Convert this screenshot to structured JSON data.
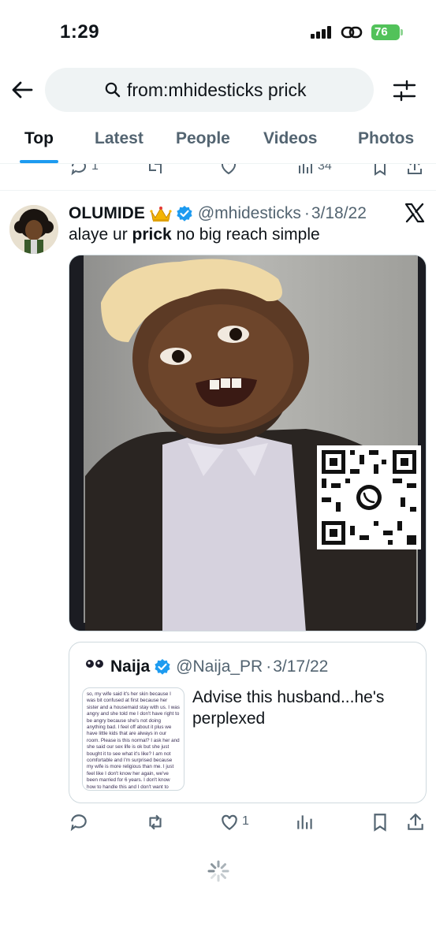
{
  "status_bar": {
    "time": "1:29",
    "battery": "76"
  },
  "search": {
    "query": "from:mhidesticks prick"
  },
  "tabs": [
    {
      "label": "Top",
      "active": true
    },
    {
      "label": "Latest",
      "active": false
    },
    {
      "label": "People",
      "active": false
    },
    {
      "label": "Videos",
      "active": false
    },
    {
      "label": "Photos",
      "active": false
    }
  ],
  "prev_tweet": {
    "replies": "1",
    "views": "34"
  },
  "tweet": {
    "author_name": "OLUMIDE",
    "author_emoji_icon": "crown-icon",
    "handle": "@mhidesticks",
    "date": "3/18/22",
    "text_before": "alaye ur ",
    "text_bold": "prick",
    "text_after": " no big reach simple",
    "quote": {
      "author_name": "Naija",
      "handle": "@Naija_PR",
      "date": "3/17/22",
      "text": "Advise this husband...he's perplexed",
      "thumb_text": "so, my wife said it's her skin because I was bit confused at first because her sister and a housemaid stay with us. I was angry and she told me I don't have right to be angry because she's not doing anything bad. I feel off about it plus we have little kids that are always in our room. Please is this normal? I ask her and she said our sex life is ok but she just bought it to see what it's like? I am not comfortable and I'm surprised because my wife is more religious than me. I just feel like I don't know her again, we've been married for 6 years. I don't know how to handle this and I don't want to discuss with someone that will"
    },
    "likes": "1"
  },
  "colors": {
    "accent": "#1d9bf0",
    "secondary_text": "#536471",
    "battery": "#52c25a"
  }
}
